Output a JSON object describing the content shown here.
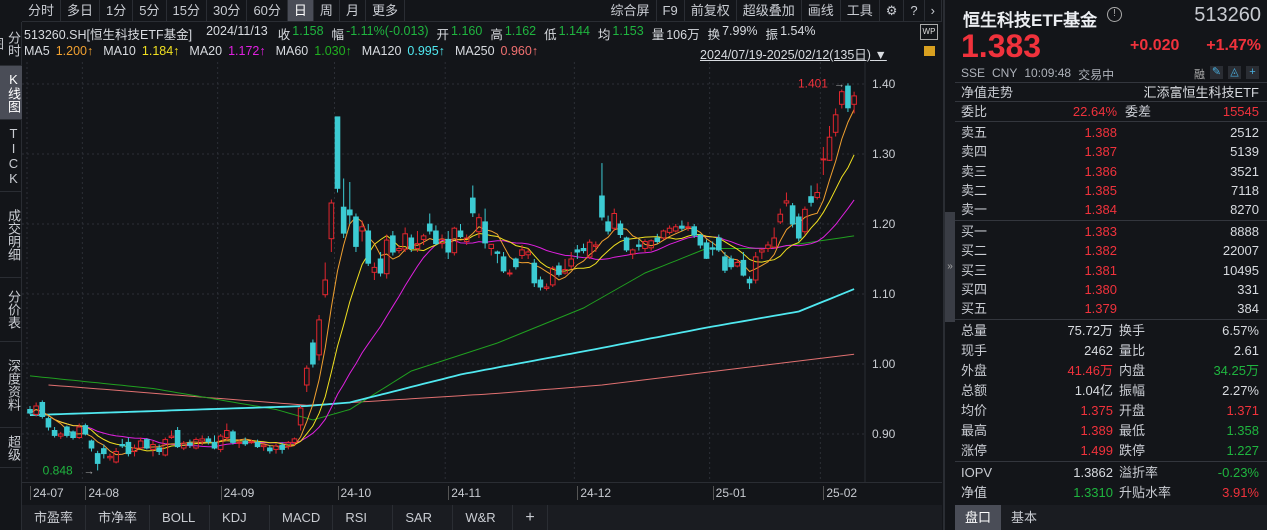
{
  "left_tabs": [
    "分时图",
    "K线图",
    "TICK",
    "成交明细",
    "分价表",
    "深度资料",
    "超级"
  ],
  "toolbar": {
    "periods": [
      "分时",
      "多日",
      "1分",
      "5分",
      "15分",
      "30分",
      "60分",
      "日",
      "周",
      "月",
      "更多"
    ],
    "active": "日",
    "tools": [
      "综合屏",
      "F9",
      "前复权",
      "超级叠加",
      "画线",
      "工具"
    ]
  },
  "info_bar": {
    "code": "513260.SH[恒生科技ETF基金]",
    "date": "2024/11/13",
    "close_label": "收",
    "close": "1.158",
    "chg_label": "幅",
    "chg": "-1.11%(-0.013)",
    "open_label": "开",
    "open": "1.160",
    "high_label": "高",
    "high": "1.162",
    "low_label": "低",
    "low": "1.144",
    "avg_label": "均",
    "avg": "1.153",
    "vol_label": "量",
    "vol": "106万",
    "turn_label": "换",
    "turn": "7.99%",
    "amp_label": "振",
    "amp": "1.54%"
  },
  "ma_bar": [
    {
      "name": "MA5",
      "value": "1.200↑",
      "color": "#f0a030"
    },
    {
      "name": "MA10",
      "value": "1.184↑",
      "color": "#f0e020"
    },
    {
      "name": "MA20",
      "value": "1.172↑",
      "color": "#e020e0"
    },
    {
      "name": "MA60",
      "value": "1.030↑",
      "color": "#20b020"
    },
    {
      "name": "MA120",
      "value": "0.995↑",
      "color": "#50e8f0"
    },
    {
      "name": "MA250",
      "value": "0.960↑",
      "color": "#f07070"
    }
  ],
  "range_label": "2024/07/19-2025/02/12(135日)",
  "chart_data": {
    "type": "candlestick",
    "y_ticks": [
      "1.40",
      "1.30",
      "1.20",
      "1.10",
      "1.00",
      "0.90"
    ],
    "ylim": [
      0.9,
      1.4
    ],
    "x_labels": [
      {
        "label": "24-07",
        "index": 0
      },
      {
        "label": "24-08",
        "index": 9
      },
      {
        "label": "24-09",
        "index": 31
      },
      {
        "label": "24-10",
        "index": 50
      },
      {
        "label": "24-11",
        "index": 68
      },
      {
        "label": "24-12",
        "index": 89
      },
      {
        "label": "25-01",
        "index": 111
      },
      {
        "label": "25-02",
        "index": 129
      }
    ],
    "max_label": "1.401",
    "max_index": 133,
    "min_label": "0.848",
    "min_index": 11,
    "ohlc": [
      [
        0.935,
        0.94,
        0.928,
        0.93
      ],
      [
        0.928,
        0.945,
        0.925,
        0.94
      ],
      [
        0.945,
        0.948,
        0.922,
        0.925
      ],
      [
        0.922,
        0.925,
        0.905,
        0.91
      ],
      [
        0.905,
        0.91,
        0.895,
        0.898
      ],
      [
        0.897,
        0.903,
        0.893,
        0.9
      ],
      [
        0.91,
        0.912,
        0.895,
        0.898
      ],
      [
        0.903,
        0.905,
        0.892,
        0.895
      ],
      [
        0.895,
        0.915,
        0.893,
        0.91
      ],
      [
        0.912,
        0.915,
        0.898,
        0.9
      ],
      [
        0.89,
        0.892,
        0.875,
        0.88
      ],
      [
        0.872,
        0.876,
        0.848,
        0.858
      ],
      [
        0.879,
        0.885,
        0.865,
        0.872
      ],
      [
        0.866,
        0.872,
        0.862,
        0.868
      ],
      [
        0.86,
        0.88,
        0.858,
        0.875
      ],
      [
        0.885,
        0.893,
        0.88,
        0.883
      ],
      [
        0.888,
        0.895,
        0.868,
        0.872
      ],
      [
        0.875,
        0.885,
        0.868,
        0.88
      ],
      [
        0.88,
        0.895,
        0.878,
        0.89
      ],
      [
        0.892,
        0.894,
        0.878,
        0.88
      ],
      [
        0.878,
        0.89,
        0.868,
        0.885
      ],
      [
        0.88,
        0.885,
        0.87,
        0.875
      ],
      [
        0.87,
        0.895,
        0.868,
        0.892
      ],
      [
        0.895,
        0.905,
        0.893,
        0.897
      ],
      [
        0.905,
        0.91,
        0.88,
        0.882
      ],
      [
        0.88,
        0.89,
        0.877,
        0.887
      ],
      [
        0.887,
        0.892,
        0.88,
        0.884
      ],
      [
        0.88,
        0.895,
        0.878,
        0.892
      ],
      [
        0.89,
        0.898,
        0.884,
        0.893
      ],
      [
        0.893,
        0.897,
        0.885,
        0.889
      ],
      [
        0.888,
        0.898,
        0.878,
        0.88
      ],
      [
        0.878,
        0.9,
        0.874,
        0.897
      ],
      [
        0.895,
        0.915,
        0.89,
        0.905
      ],
      [
        0.903,
        0.906,
        0.885,
        0.888
      ],
      [
        0.887,
        0.892,
        0.88,
        0.888
      ],
      [
        0.89,
        0.895,
        0.883,
        0.886
      ],
      [
        0.888,
        0.892,
        0.886,
        0.889
      ],
      [
        0.888,
        0.892,
        0.88,
        0.882
      ],
      [
        0.882,
        0.886,
        0.876,
        0.884
      ],
      [
        0.88,
        0.884,
        0.872,
        0.876
      ],
      [
        0.878,
        0.886,
        0.872,
        0.883
      ],
      [
        0.884,
        0.888,
        0.872,
        0.878
      ],
      [
        0.882,
        0.89,
        0.878,
        0.888
      ],
      [
        0.888,
        0.895,
        0.884,
        0.893
      ],
      [
        0.913,
        0.94,
        0.905,
        0.937
      ],
      [
        0.97,
        0.998,
        0.96,
        0.994
      ],
      [
        1.03,
        1.035,
        0.995,
        1.0
      ],
      [
        1.013,
        1.07,
        1.005,
        1.063
      ],
      [
        1.099,
        1.145,
        1.095,
        1.12
      ],
      [
        1.179,
        1.235,
        1.16,
        1.23
      ],
      [
        1.353,
        1.353,
        1.245,
        1.251
      ],
      [
        1.224,
        1.265,
        1.18,
        1.187
      ],
      [
        1.22,
        1.26,
        1.2,
        1.213
      ],
      [
        1.21,
        1.215,
        1.16,
        1.168
      ],
      [
        1.19,
        1.205,
        1.175,
        1.196
      ],
      [
        1.19,
        1.2,
        1.14,
        1.144
      ],
      [
        1.131,
        1.145,
        1.12,
        1.138
      ],
      [
        1.15,
        1.16,
        1.125,
        1.13
      ],
      [
        1.129,
        1.185,
        1.122,
        1.177
      ],
      [
        1.183,
        1.19,
        1.155,
        1.16
      ],
      [
        1.162,
        1.17,
        1.158,
        1.165
      ],
      [
        1.164,
        1.195,
        1.16,
        1.186
      ],
      [
        1.18,
        1.185,
        1.16,
        1.165
      ],
      [
        1.165,
        1.19,
        1.16,
        1.172
      ],
      [
        1.178,
        1.186,
        1.17,
        1.183
      ],
      [
        1.2,
        1.215,
        1.185,
        1.19
      ],
      [
        1.19,
        1.198,
        1.17,
        1.172
      ],
      [
        1.172,
        1.185,
        1.165,
        1.178
      ],
      [
        1.178,
        1.19,
        1.15,
        1.16
      ],
      [
        1.159,
        1.196,
        1.155,
        1.194
      ],
      [
        1.19,
        1.2,
        1.18,
        1.182
      ],
      [
        1.175,
        1.185,
        1.17,
        1.18
      ],
      [
        1.237,
        1.255,
        1.21,
        1.216
      ],
      [
        1.189,
        1.215,
        1.18,
        1.209
      ],
      [
        1.203,
        1.222,
        1.165,
        1.173
      ],
      [
        1.165,
        1.17,
        1.155,
        1.171
      ],
      [
        1.16,
        1.162,
        1.144,
        1.158
      ],
      [
        1.153,
        1.16,
        1.13,
        1.133
      ],
      [
        1.13,
        1.135,
        1.125,
        1.13
      ],
      [
        1.15,
        1.152,
        1.135,
        1.139
      ],
      [
        1.155,
        1.17,
        1.15,
        1.163
      ],
      [
        1.156,
        1.165,
        1.15,
        1.16
      ],
      [
        1.144,
        1.15,
        1.11,
        1.116
      ],
      [
        1.12,
        1.125,
        1.105,
        1.11
      ],
      [
        1.108,
        1.115,
        1.105,
        1.11
      ],
      [
        1.113,
        1.14,
        1.11,
        1.137
      ],
      [
        1.14,
        1.145,
        1.125,
        1.128
      ],
      [
        1.13,
        1.15,
        1.128,
        1.135
      ],
      [
        1.14,
        1.16,
        1.135,
        1.15
      ],
      [
        1.163,
        1.17,
        1.15,
        1.16
      ],
      [
        1.165,
        1.172,
        1.158,
        1.162
      ],
      [
        1.153,
        1.178,
        1.15,
        1.174
      ],
      [
        1.168,
        1.175,
        1.16,
        1.17
      ],
      [
        1.24,
        1.287,
        1.205,
        1.21
      ],
      [
        1.203,
        1.212,
        1.185,
        1.19
      ],
      [
        1.194,
        1.222,
        1.19,
        1.215
      ],
      [
        1.2,
        1.205,
        1.18,
        1.185
      ],
      [
        1.18,
        1.182,
        1.16,
        1.163
      ],
      [
        1.157,
        1.165,
        1.15,
        1.163
      ],
      [
        1.17,
        1.178,
        1.162,
        1.168
      ],
      [
        1.165,
        1.178,
        1.16,
        1.175
      ],
      [
        1.166,
        1.178,
        1.162,
        1.176
      ],
      [
        1.18,
        1.186,
        1.172,
        1.175
      ],
      [
        1.18,
        1.192,
        1.178,
        1.19
      ],
      [
        1.188,
        1.198,
        1.185,
        1.194
      ],
      [
        1.19,
        1.2,
        1.188,
        1.196
      ],
      [
        1.197,
        1.205,
        1.19,
        1.194
      ],
      [
        1.195,
        1.203,
        1.19,
        1.196
      ],
      [
        1.196,
        1.2,
        1.18,
        1.184
      ],
      [
        1.184,
        1.186,
        1.165,
        1.17
      ],
      [
        1.173,
        1.178,
        1.15,
        1.151
      ],
      [
        1.166,
        1.175,
        1.155,
        1.164
      ],
      [
        1.18,
        1.185,
        1.16,
        1.163
      ],
      [
        1.153,
        1.16,
        1.13,
        1.134
      ],
      [
        1.15,
        1.155,
        1.135,
        1.139
      ],
      [
        1.14,
        1.15,
        1.138,
        1.145
      ],
      [
        1.148,
        1.16,
        1.125,
        1.127
      ],
      [
        1.121,
        1.125,
        1.107,
        1.116
      ],
      [
        1.12,
        1.16,
        1.115,
        1.153
      ],
      [
        1.16,
        1.165,
        1.15,
        1.163
      ],
      [
        1.165,
        1.175,
        1.16,
        1.17
      ],
      [
        1.167,
        1.195,
        1.165,
        1.18
      ],
      [
        1.203,
        1.222,
        1.2,
        1.214
      ],
      [
        1.23,
        1.245,
        1.225,
        1.233
      ],
      [
        1.226,
        1.23,
        1.195,
        1.2
      ],
      [
        1.21,
        1.215,
        1.175,
        1.18
      ],
      [
        1.189,
        1.225,
        1.185,
        1.221
      ],
      [
        1.239,
        1.255,
        1.225,
        1.231
      ],
      [
        1.238,
        1.258,
        1.235,
        1.245
      ],
      [
        1.293,
        1.31,
        1.27,
        1.293
      ],
      [
        1.291,
        1.34,
        1.29,
        1.324
      ],
      [
        1.331,
        1.365,
        1.325,
        1.356
      ],
      [
        1.371,
        1.392,
        1.365,
        1.389
      ],
      [
        1.397,
        1.401,
        1.36,
        1.366
      ],
      [
        1.371,
        1.389,
        1.358,
        1.383
      ]
    ],
    "ma_long": {
      "MA60": [
        [
          0,
          0.983
        ],
        [
          20,
          0.965
        ],
        [
          40,
          0.935
        ],
        [
          46,
          0.92
        ],
        [
          52,
          0.935
        ],
        [
          62,
          0.99
        ],
        [
          76,
          1.03
        ],
        [
          90,
          1.08
        ],
        [
          100,
          1.13
        ],
        [
          110,
          1.165
        ],
        [
          120,
          1.165
        ],
        [
          134,
          1.183
        ]
      ],
      "MA120": [
        [
          0,
          0.927
        ],
        [
          45,
          0.94
        ],
        [
          52,
          0.945
        ],
        [
          70,
          0.985
        ],
        [
          76,
          0.995
        ],
        [
          93,
          1.023
        ],
        [
          110,
          1.052
        ],
        [
          125,
          1.075
        ],
        [
          134,
          1.107
        ]
      ],
      "MA250": [
        [
          3,
          0.97
        ],
        [
          45,
          0.941
        ],
        [
          76,
          0.958
        ],
        [
          93,
          0.97
        ],
        [
          134,
          1.014
        ]
      ]
    }
  },
  "bottom_tabs": [
    "市盈率",
    "市净率",
    "BOLL",
    "KDJ",
    "MACD",
    "RSI",
    "SAR",
    "W&R",
    "+"
  ],
  "quote": {
    "name": "恒生科技ETF基金",
    "code": "513260",
    "price": "1.383",
    "change": "+0.020",
    "pct": "+1.47%",
    "exchange": "SSE",
    "currency": "CNY",
    "time": "10:09:48",
    "status": "交易中",
    "margin": "融",
    "nav_trend": "净值走势",
    "fund_name": "汇添富恒生科技ETF",
    "weibi_label": "委比",
    "weibi": "22.64%",
    "weicha_label": "委差",
    "weicha": "15545"
  },
  "asks": [
    {
      "label": "卖五",
      "price": "1.388",
      "vol": "2512"
    },
    {
      "label": "卖四",
      "price": "1.387",
      "vol": "5139"
    },
    {
      "label": "卖三",
      "price": "1.386",
      "vol": "3521"
    },
    {
      "label": "卖二",
      "price": "1.385",
      "vol": "7118"
    },
    {
      "label": "卖一",
      "price": "1.384",
      "vol": "8270"
    }
  ],
  "bids": [
    {
      "label": "买一",
      "price": "1.383",
      "vol": "8888"
    },
    {
      "label": "买二",
      "price": "1.382",
      "vol": "22007"
    },
    {
      "label": "买三",
      "price": "1.381",
      "vol": "10495"
    },
    {
      "label": "买四",
      "price": "1.380",
      "vol": "331"
    },
    {
      "label": "买五",
      "price": "1.379",
      "vol": "384"
    }
  ],
  "stats": [
    {
      "l1": "总量",
      "v1": "75.72万",
      "c1": "w",
      "l2": "换手",
      "v2": "6.57%",
      "c2": "w"
    },
    {
      "l1": "现手",
      "v1": "2462",
      "c1": "w",
      "l2": "量比",
      "v2": "2.61",
      "c2": "w"
    },
    {
      "l1": "外盘",
      "v1": "41.46万",
      "c1": "r",
      "l2": "内盘",
      "v2": "34.25万",
      "c2": "g"
    },
    {
      "l1": "总额",
      "v1": "1.04亿",
      "c1": "w",
      "l2": "振幅",
      "v2": "2.27%",
      "c2": "w"
    },
    {
      "l1": "均价",
      "v1": "1.375",
      "c1": "r",
      "l2": "开盘",
      "v2": "1.371",
      "c2": "r"
    },
    {
      "l1": "最高",
      "v1": "1.389",
      "c1": "r",
      "l2": "最低",
      "v2": "1.358",
      "c2": "g"
    },
    {
      "l1": "涨停",
      "v1": "1.499",
      "c1": "r",
      "l2": "跌停",
      "v2": "1.227",
      "c2": "g"
    }
  ],
  "stats2": [
    {
      "l1": "IOPV",
      "v1": "1.3862",
      "c1": "w",
      "l2": "溢折率",
      "v2": "-0.23%",
      "c2": "g"
    },
    {
      "l1": "净值",
      "v1": "1.3310",
      "c1": "g",
      "l2": "升贴水率",
      "v2": "3.91%",
      "c2": "r"
    }
  ],
  "right_tabs": [
    "盘口",
    "基本"
  ],
  "colors": {
    "up": "#e0262e",
    "down": "#3ccbd3",
    "red_text": "#f0323c",
    "green_text": "#1fb53f"
  }
}
